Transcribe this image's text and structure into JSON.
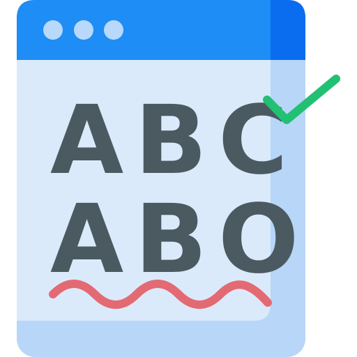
{
  "spell_check": {
    "lines": [
      "ABC",
      "ABO"
    ],
    "colors": {
      "window_frame": "#b7d6f8",
      "window_page": "#dbeafb",
      "title_bar": "#1e8df5",
      "title_bar_shade": "#0a6df0",
      "dots": "#b8d9fb",
      "text": "#4b5a60",
      "misspelling_underline": "#e36a73",
      "check_mark": "#22c073"
    },
    "icons": {
      "window": "browser-window-icon",
      "dots": "window-control-dots-icon",
      "check": "check-mark-icon",
      "underline": "spelling-error-squiggle-icon"
    }
  }
}
